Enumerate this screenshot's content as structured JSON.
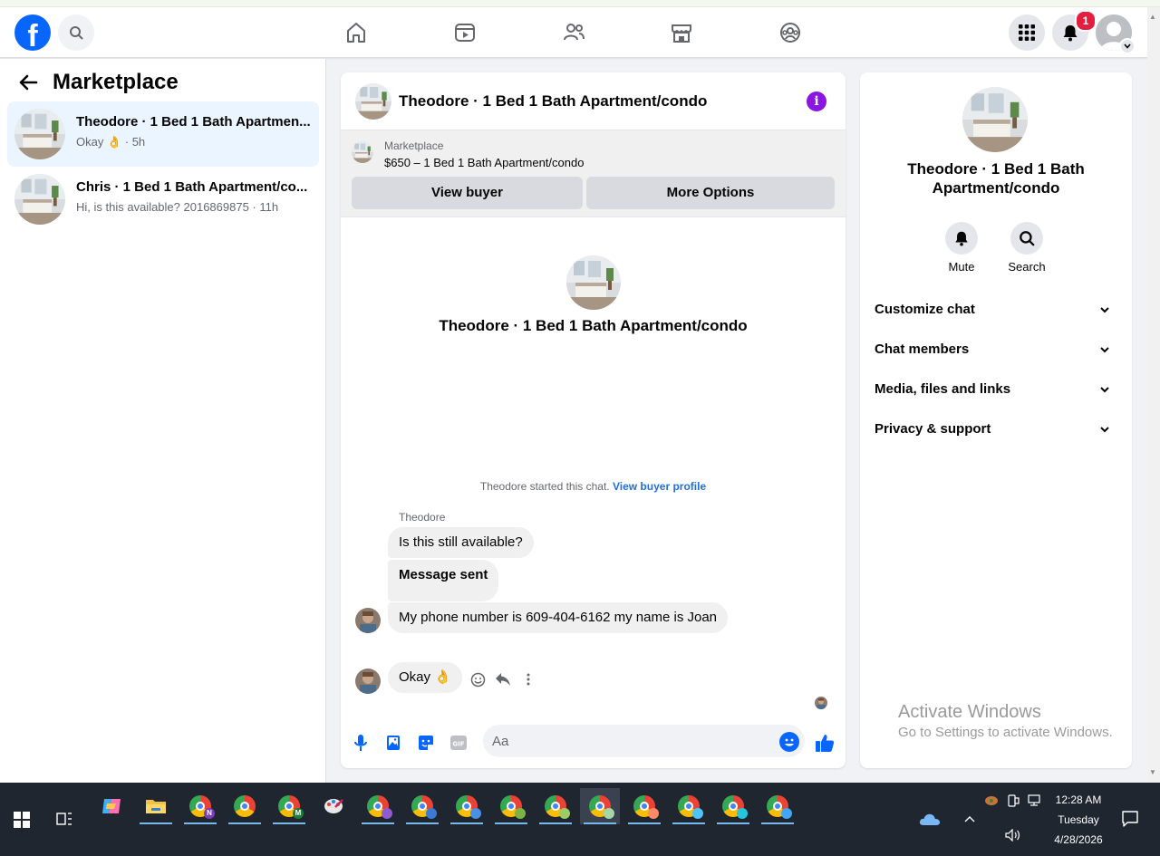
{
  "nav": {
    "logo_letter": "f",
    "notification_count": "1"
  },
  "sidebar": {
    "title": "Marketplace",
    "conversations": [
      {
        "title": "Theodore · 1 Bed 1 Bath Apartmen...",
        "subtitle": "Okay 👌 · 5h"
      },
      {
        "title": "Chris · 1 Bed 1 Bath Apartment/co...",
        "subtitle": "Hi, is this available? 2016869875 · 11h"
      }
    ]
  },
  "chat": {
    "header_title": "Theodore · 1 Bed 1 Bath Apartment/condo",
    "info_glyph": "i",
    "marketplace_label": "Marketplace",
    "listing": "$650 – 1 Bed 1 Bath Apartment/condo",
    "view_buyer_label": "View buyer",
    "more_options_label": "More Options",
    "intro_title": "Theodore · 1 Bed 1 Bath Apartment/condo",
    "started_text": "Theodore started this chat.",
    "view_buyer_profile_link": "View buyer profile",
    "sender_name": "Theodore",
    "messages": [
      "Is this still available?",
      "Message sent",
      "My phone number is 609-404-6162 my name is Joan",
      "Okay 👌"
    ],
    "composer_placeholder": "Aa"
  },
  "info_panel": {
    "title": "Theodore · 1 Bed 1 Bath Apartment/condo",
    "mute_label": "Mute",
    "search_label": "Search",
    "rows": [
      "Customize chat",
      "Chat members",
      "Media, files and links",
      "Privacy & support"
    ]
  },
  "watermark": {
    "line1": "Activate Windows",
    "line2": "Go to Settings to activate Windows."
  },
  "taskbar": {
    "time": "12:28 AM",
    "day": "Tuesday",
    "date": "4/28/2026"
  },
  "colors": {
    "fb_blue": "#0866ff",
    "info_purple": "#8a16e0",
    "link_blue": "#216fdb",
    "active_conv_bg": "#ebf5ff",
    "badge_red": "#e41e3f"
  }
}
